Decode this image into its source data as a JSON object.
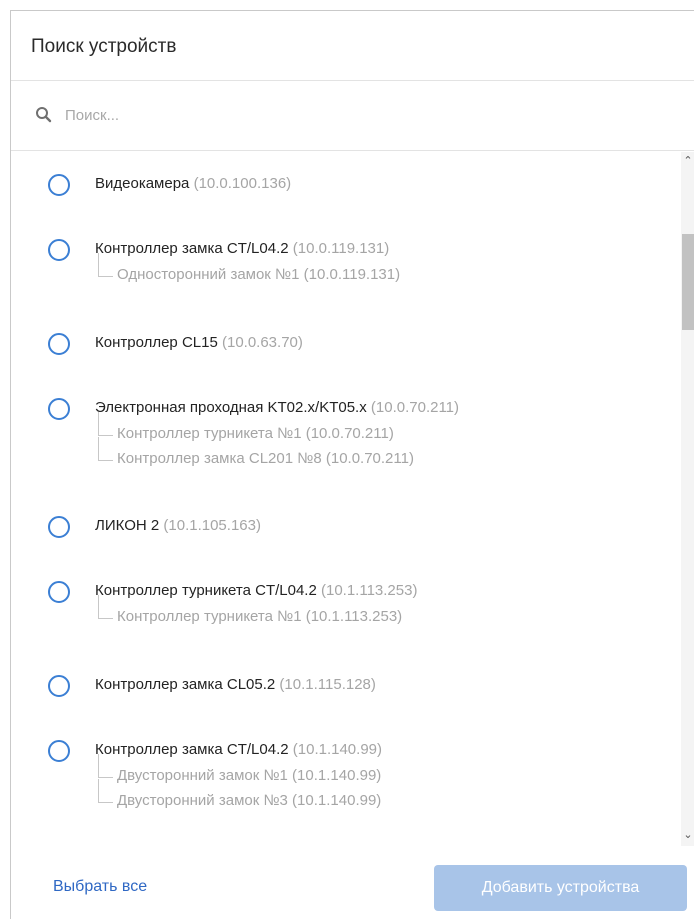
{
  "dialog": {
    "title": "Поиск устройств",
    "search_placeholder": "Поиск...",
    "select_all_label": "Выбрать все",
    "add_button_label": "Добавить устройства"
  },
  "devices": [
    {
      "name": "Видеокамера",
      "ip": "(10.0.100.136)",
      "children": []
    },
    {
      "name": "Контроллер замка CT/L04.2",
      "ip": "(10.0.119.131)",
      "children": [
        "Односторонний замок №1 (10.0.119.131)"
      ]
    },
    {
      "name": "Контроллер CL15",
      "ip": "(10.0.63.70)",
      "children": []
    },
    {
      "name": "Электронная проходная KT02.x/KT05.x",
      "ip": "(10.0.70.211)",
      "children": [
        "Контроллер турникета №1 (10.0.70.211)",
        "Контроллер замка CL201 №8 (10.0.70.211)"
      ]
    },
    {
      "name": "ЛИКОН 2",
      "ip": "(10.1.105.163)",
      "children": []
    },
    {
      "name": "Контроллер турникета CT/L04.2",
      "ip": "(10.1.113.253)",
      "children": [
        "Контроллер турникета №1 (10.1.113.253)"
      ]
    },
    {
      "name": "Контроллер замка CL05.2",
      "ip": "(10.1.115.128)",
      "children": []
    },
    {
      "name": "Контроллер замка CT/L04.2",
      "ip": "(10.1.140.99)",
      "children": [
        "Двусторонний замок №1 (10.1.140.99)",
        "Двусторонний замок №3 (10.1.140.99)"
      ]
    }
  ],
  "colors": {
    "accent": "#3b7fd4",
    "link": "#2f68c4",
    "button_disabled": "#a8c4e8"
  },
  "icons": {
    "search": "search-icon",
    "scroll_up": "chevron-up-icon",
    "scroll_down": "chevron-down-icon"
  }
}
